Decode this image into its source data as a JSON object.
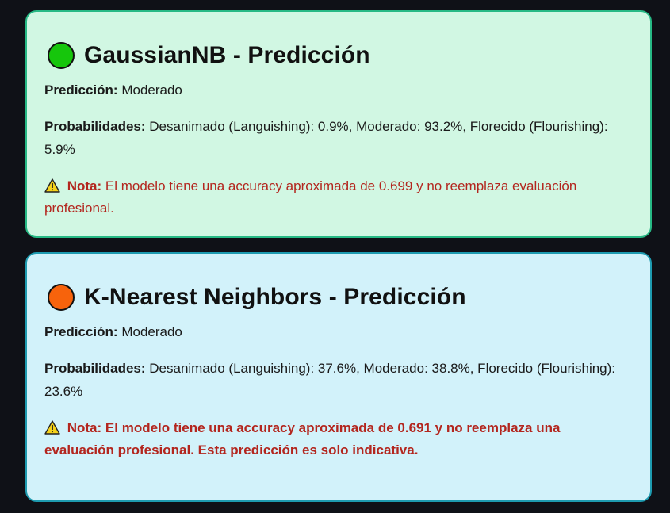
{
  "cards": [
    {
      "dot_color": "#16c60c",
      "icon": "green-circle-icon",
      "title": "GaussianNB - Predicción",
      "prediction_label": "Predicción:",
      "prediction_value": "Moderado",
      "probabilities_label": "Probabilidades:",
      "probabilities_value": "Desanimado (Languishing): 0.9%, Moderado: 93.2%, Florecido (Flourishing): 5.9%",
      "note_icon": "warning-icon",
      "note_label": "Nota:",
      "note_text": "El modelo tiene una accuracy aproximada de 0.699 y no reemplaza evaluación profesional."
    },
    {
      "dot_color": "#f7630c",
      "icon": "orange-circle-icon",
      "title": "K-Nearest Neighbors - Predicción",
      "prediction_label": "Predicción:",
      "prediction_value": "Moderado",
      "probabilities_label": "Probabilidades:",
      "probabilities_value": "Desanimado (Languishing): 37.6%, Moderado: 38.8%, Florecido (Flourishing): 23.6%",
      "note_icon": "warning-icon",
      "note_label": "Nota:",
      "note_text": "El modelo tiene una accuracy aproximada de 0.691 y no reemplaza una evaluación profesional. Esta predicción es solo indicativa."
    }
  ],
  "colors": {
    "background": "#0f1117",
    "green_card_bg": "#d1f7e3",
    "green_card_border": "#27b985",
    "blue_card_bg": "#d2f2fa",
    "blue_card_border": "#1e9bb0",
    "note_text": "#b3261e"
  }
}
